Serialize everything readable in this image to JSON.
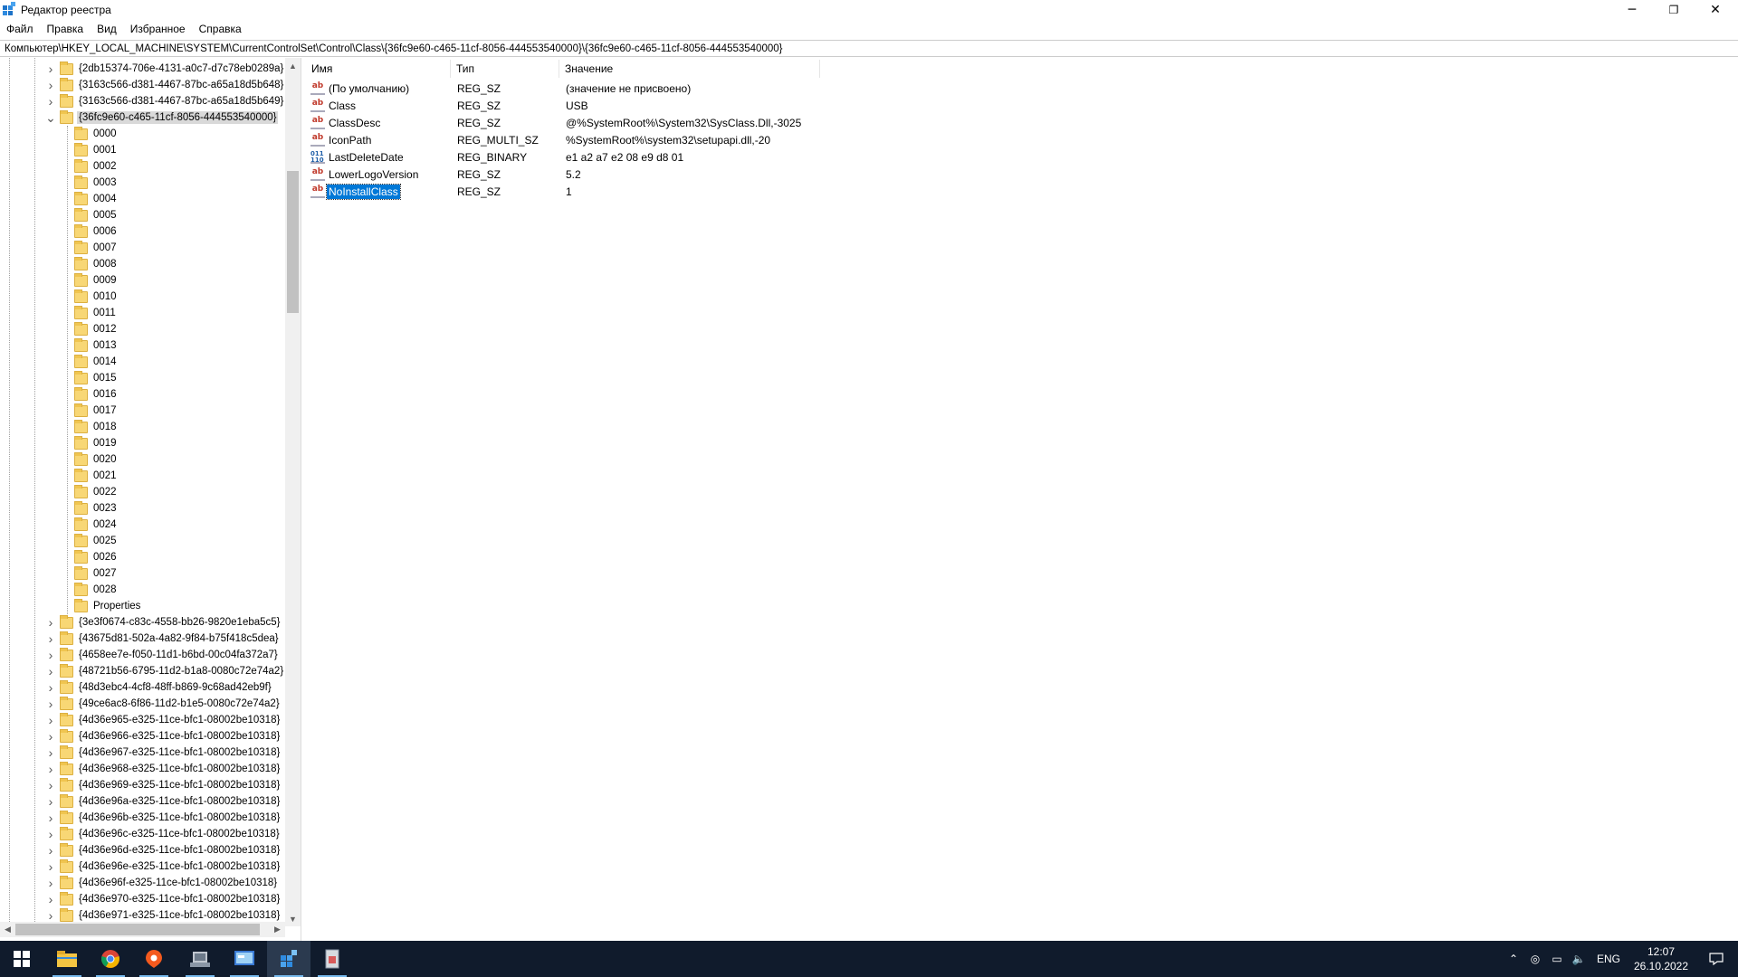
{
  "window": {
    "title": "Редактор реестра",
    "controls": {
      "minimize": "─",
      "restore": "❐",
      "close": "✕"
    }
  },
  "menu": [
    "Файл",
    "Правка",
    "Вид",
    "Избранное",
    "Справка"
  ],
  "address": "Компьютер\\HKEY_LOCAL_MACHINE\\SYSTEM\\CurrentControlSet\\Control\\Class\\{36fc9e60-c465-11cf-8056-444553540000}\\{36fc9e60-c465-11cf-8056-444553540000}",
  "tree": {
    "above": [
      "{2db15374-706e-4131-a0c7-d7c78eb0289a}",
      "{3163c566-d381-4467-87bc-a65a18d5b648}",
      "{3163c566-d381-4467-87bc-a65a18d5b649}"
    ],
    "expanded": "{36fc9e60-c465-11cf-8056-444553540000}",
    "children": [
      "0000",
      "0001",
      "0002",
      "0003",
      "0004",
      "0005",
      "0006",
      "0007",
      "0008",
      "0009",
      "0010",
      "0011",
      "0012",
      "0013",
      "0014",
      "0015",
      "0016",
      "0017",
      "0018",
      "0019",
      "0020",
      "0021",
      "0022",
      "0023",
      "0024",
      "0025",
      "0026",
      "0027",
      "0028",
      "Properties"
    ],
    "below": [
      "{3e3f0674-c83c-4558-bb26-9820e1eba5c5}",
      "{43675d81-502a-4a82-9f84-b75f418c5dea}",
      "{4658ee7e-f050-11d1-b6bd-00c04fa372a7}",
      "{48721b56-6795-11d2-b1a8-0080c72e74a2}",
      "{48d3ebc4-4cf8-48ff-b869-9c68ad42eb9f}",
      "{49ce6ac8-6f86-11d2-b1e5-0080c72e74a2}",
      "{4d36e965-e325-11ce-bfc1-08002be10318}",
      "{4d36e966-e325-11ce-bfc1-08002be10318}",
      "{4d36e967-e325-11ce-bfc1-08002be10318}",
      "{4d36e968-e325-11ce-bfc1-08002be10318}",
      "{4d36e969-e325-11ce-bfc1-08002be10318}",
      "{4d36e96a-e325-11ce-bfc1-08002be10318}",
      "{4d36e96b-e325-11ce-bfc1-08002be10318}",
      "{4d36e96c-e325-11ce-bfc1-08002be10318}",
      "{4d36e96d-e325-11ce-bfc1-08002be10318}",
      "{4d36e96e-e325-11ce-bfc1-08002be10318}",
      "{4d36e96f-e325-11ce-bfc1-08002be10318}",
      "{4d36e970-e325-11ce-bfc1-08002be10318}",
      "{4d36e971-e325-11ce-bfc1-08002be10318}"
    ]
  },
  "list": {
    "headers": {
      "name": "Имя",
      "type": "Тип",
      "value": "Значение"
    },
    "rows": [
      {
        "name": "(По умолчанию)",
        "type": "REG_SZ",
        "value": "(значение не присвоено)",
        "icon": "ab"
      },
      {
        "name": "Class",
        "type": "REG_SZ",
        "value": "USB",
        "icon": "ab"
      },
      {
        "name": "ClassDesc",
        "type": "REG_SZ",
        "value": "@%SystemRoot%\\System32\\SysClass.Dll,-3025",
        "icon": "ab"
      },
      {
        "name": "IconPath",
        "type": "REG_MULTI_SZ",
        "value": "%SystemRoot%\\system32\\setupapi.dll,-20",
        "icon": "ab"
      },
      {
        "name": "LastDeleteDate",
        "type": "REG_BINARY",
        "value": "e1 a2 a7 e2 08 e9 d8 01",
        "icon": "bin"
      },
      {
        "name": "LowerLogoVersion",
        "type": "REG_SZ",
        "value": "5.2",
        "icon": "ab"
      },
      {
        "name": "NoInstallClass",
        "type": "REG_SZ",
        "value": "1",
        "icon": "ab",
        "selected": true
      }
    ]
  },
  "taskbar": {
    "apps": [
      "start-icon",
      "file-explorer-icon",
      "chrome-icon",
      "yandex-browser-icon",
      "app-icon",
      "control-panel-icon",
      "registry-editor-icon",
      "app-icon-2"
    ],
    "lang": "ENG",
    "time": "12:07",
    "date": "26.10.2022"
  }
}
